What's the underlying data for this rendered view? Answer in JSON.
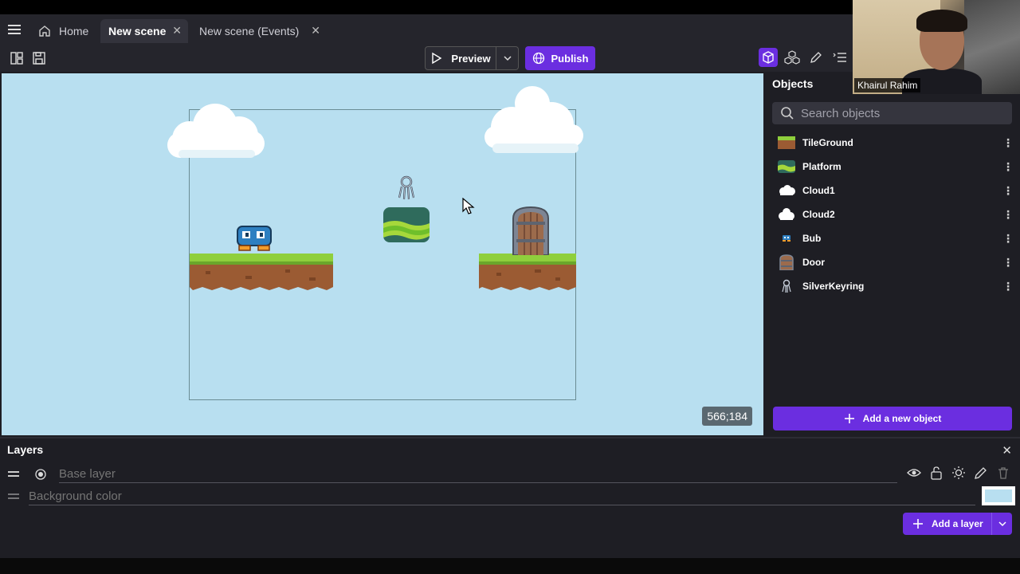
{
  "tabs": {
    "home": "Home",
    "scene": "New scene",
    "events": "New scene (Events)",
    "close_glyph": "✕"
  },
  "toolbar": {
    "preview_label": "Preview",
    "publish_label": "Publish"
  },
  "canvas": {
    "background_color": "#b8dff0",
    "cursor_coordinates": "566;184"
  },
  "objects": {
    "title": "Objects",
    "search_placeholder": "Search objects",
    "items": [
      {
        "name": "TileGround",
        "icon": "tileground-icon"
      },
      {
        "name": "Platform",
        "icon": "platform-icon"
      },
      {
        "name": "Cloud1",
        "icon": "cloud-icon"
      },
      {
        "name": "Cloud2",
        "icon": "cloud-icon"
      },
      {
        "name": "Bub",
        "icon": "bub-icon"
      },
      {
        "name": "Door",
        "icon": "door-icon"
      },
      {
        "name": "SilverKeyring",
        "icon": "keyring-icon"
      }
    ],
    "add_label": "Add a new object"
  },
  "webcam": {
    "name": "Khairul Rahim"
  },
  "layers": {
    "title": "Layers",
    "base_layer": "Base layer",
    "background_color": "Background color",
    "add_label": "Add a layer"
  },
  "colors": {
    "accent": "#6b2ee0",
    "panel": "#1e1e24",
    "sky": "#b8dff0"
  }
}
